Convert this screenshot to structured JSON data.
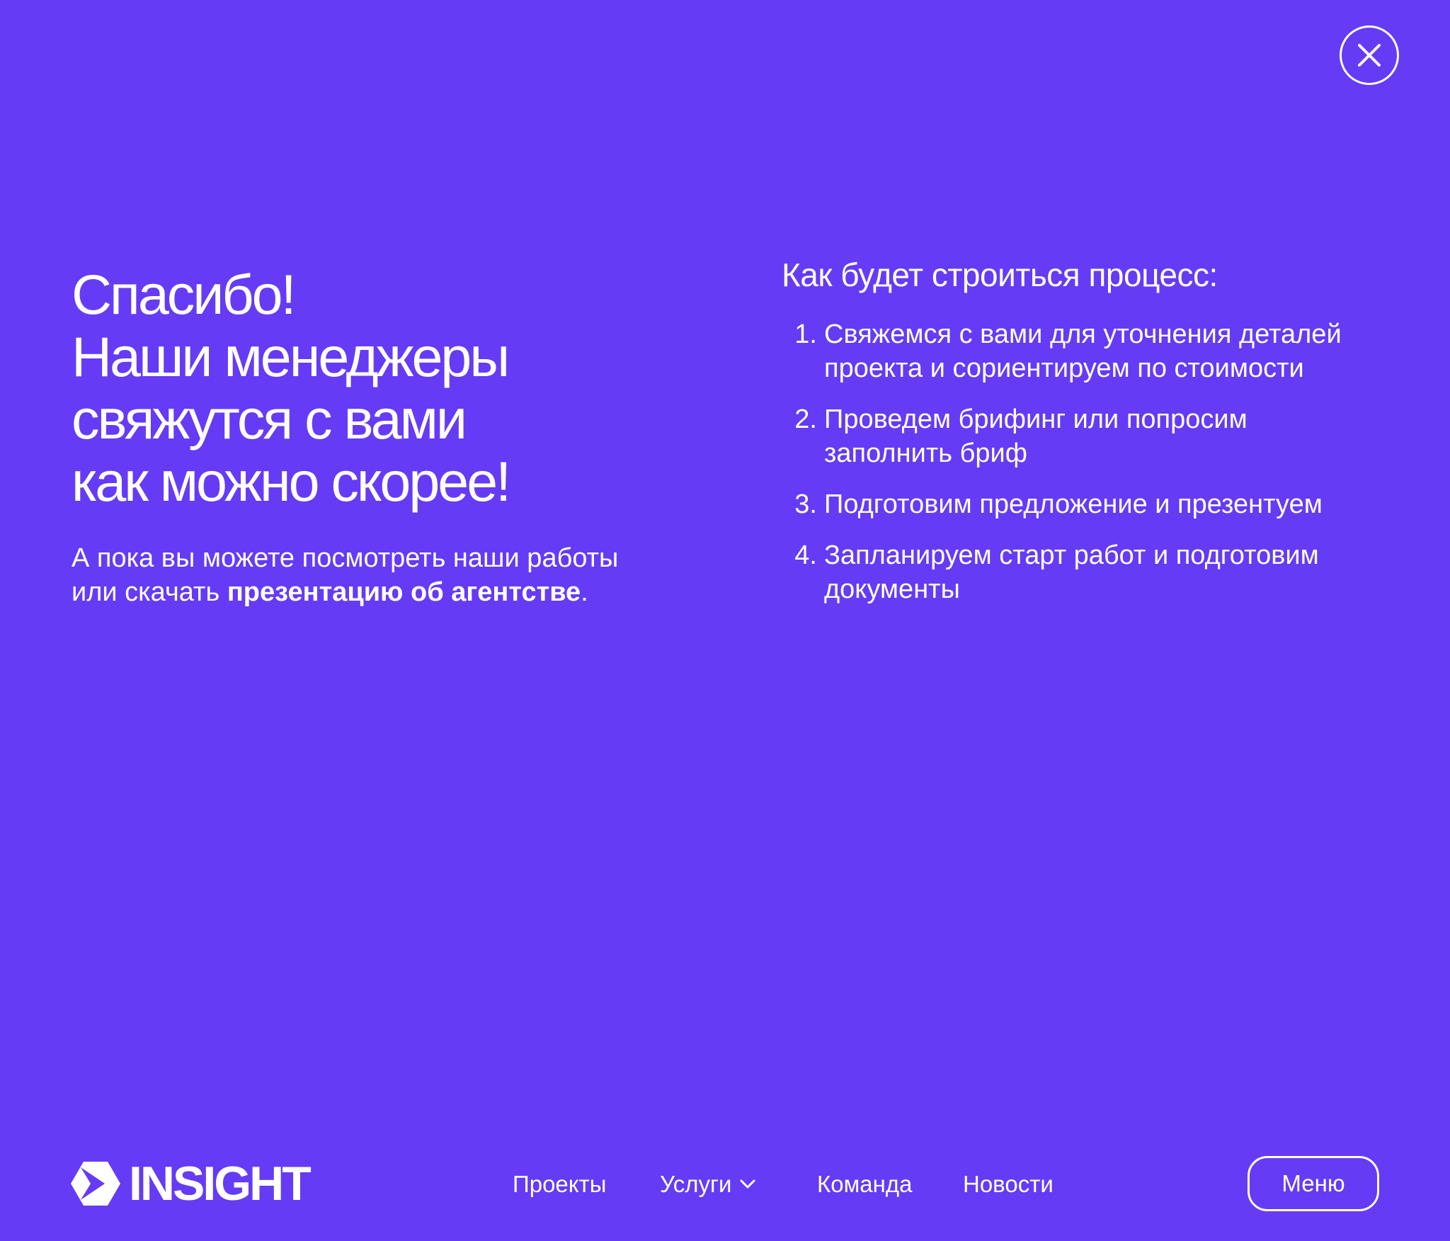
{
  "close": {
    "icon": "close-icon"
  },
  "thank_you": {
    "headline_lines": [
      "Спасибо!",
      "Наши менеджеры",
      "свяжутся с вами",
      "как можно скорее!"
    ],
    "lead_line1": "А пока вы можете посмотреть наши работы",
    "lead_line2_prefix": "или скачать ",
    "lead_link": "презентацию об агентстве",
    "lead_suffix": "."
  },
  "process": {
    "title": "Как будет строиться процесс:",
    "steps": [
      {
        "num": "1.",
        "lines": [
          "Свяжемся с вами для уточнения деталей",
          "проекта и сориентируем по стоимости"
        ]
      },
      {
        "num": "2.",
        "lines": [
          "Проведем брифинг или попросим",
          "заполнить бриф"
        ]
      },
      {
        "num": "3.",
        "lines": [
          "Подготовим предложение и презентуем"
        ]
      },
      {
        "num": "4.",
        "lines": [
          "Запланируем старт работ и подготовим",
          "документы"
        ]
      }
    ]
  },
  "footer": {
    "logo_text": "INSIGHT",
    "logo_icon": "insight-logo-icon",
    "nav": {
      "projects": "Проекты",
      "services": "Услуги",
      "team": "Команда",
      "news": "Новости"
    },
    "menu_label": "Меню"
  },
  "colors": {
    "background": "#653bf5",
    "foreground": "#ffffff"
  }
}
